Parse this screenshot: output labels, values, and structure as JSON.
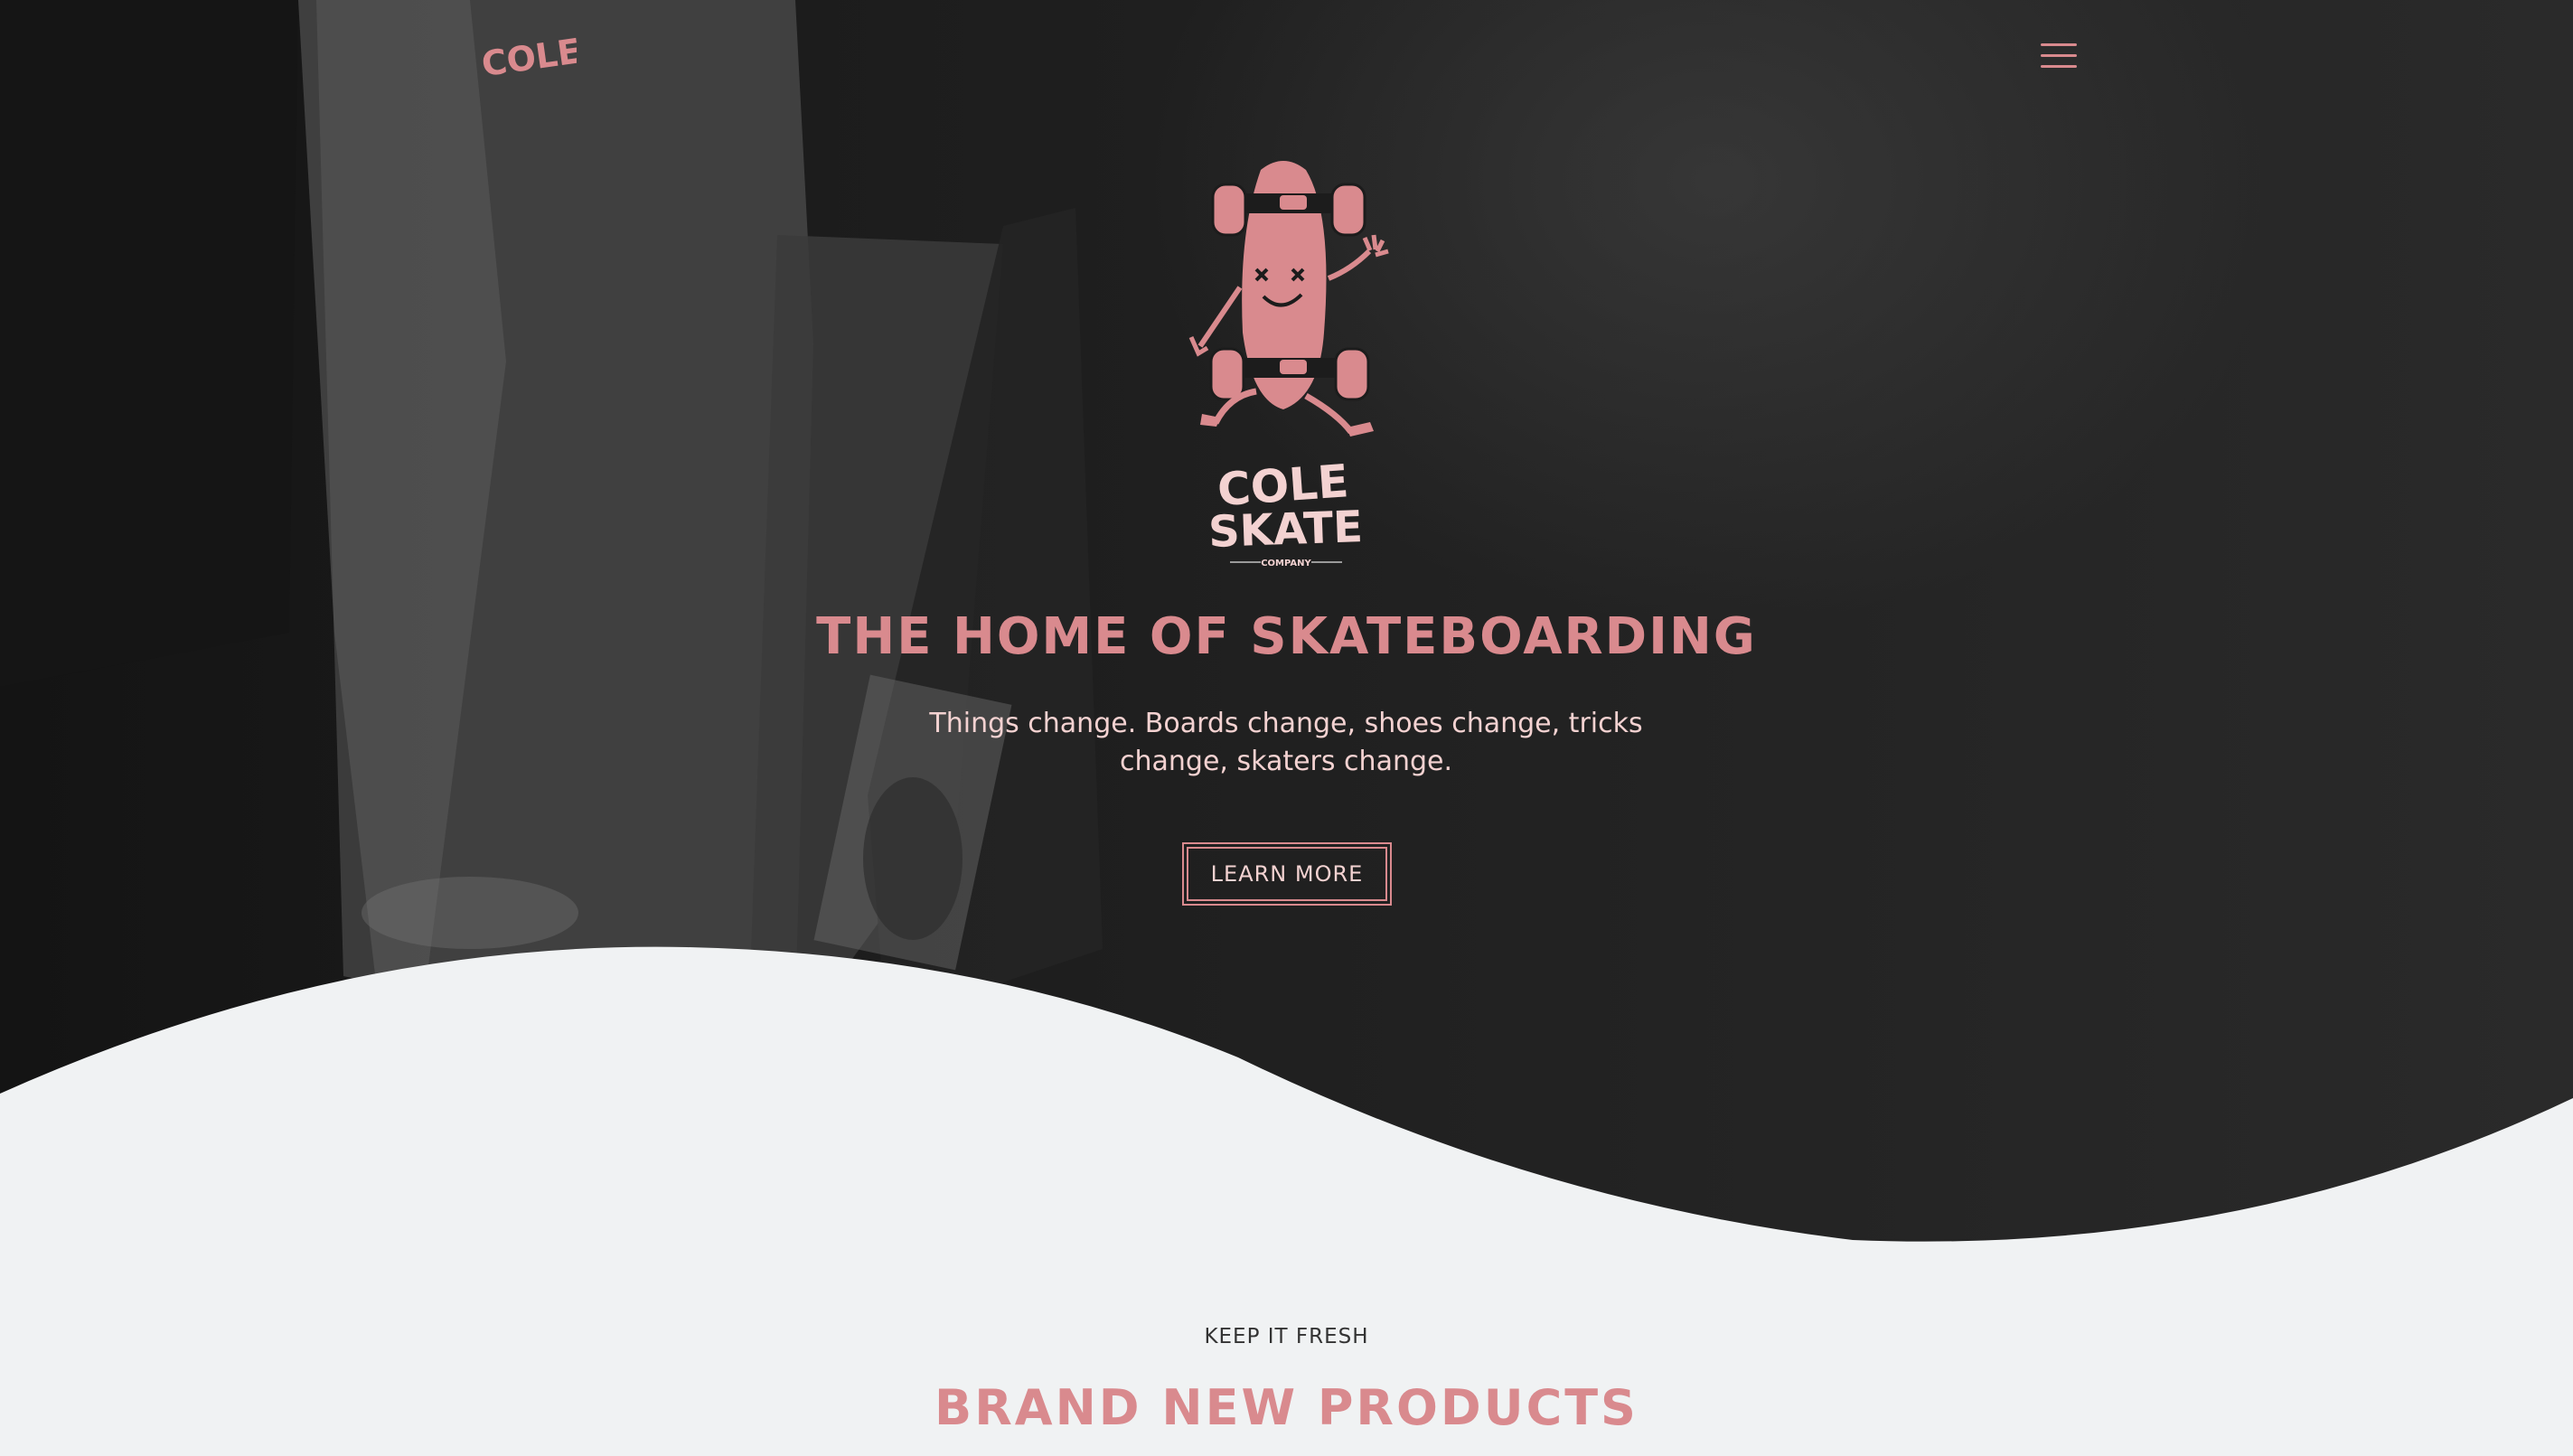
{
  "colors": {
    "accent_pink": "#d98a8e",
    "light_pink_text": "#f3d2d1",
    "hero_dark": "#1c1c1c",
    "section_background": "#f0f2f3"
  },
  "nav": {
    "logo_text": "COLE",
    "menu_icon": "hamburger-menu-icon"
  },
  "hero": {
    "mascot_icon": "skateboard-mascot-icon",
    "brand_logo": {
      "line1": "COLE",
      "line2": "SKATE",
      "line3": "COMPANY"
    },
    "title": "THE HOME OF SKATEBOARDING",
    "subtitle": "Things change. Boards change, shoes change, tricks change, skaters change.",
    "cta_label": "LEARN MORE"
  },
  "products_section": {
    "eyebrow": "KEEP IT FRESH",
    "title": "BRAND NEW PRODUCTS"
  }
}
